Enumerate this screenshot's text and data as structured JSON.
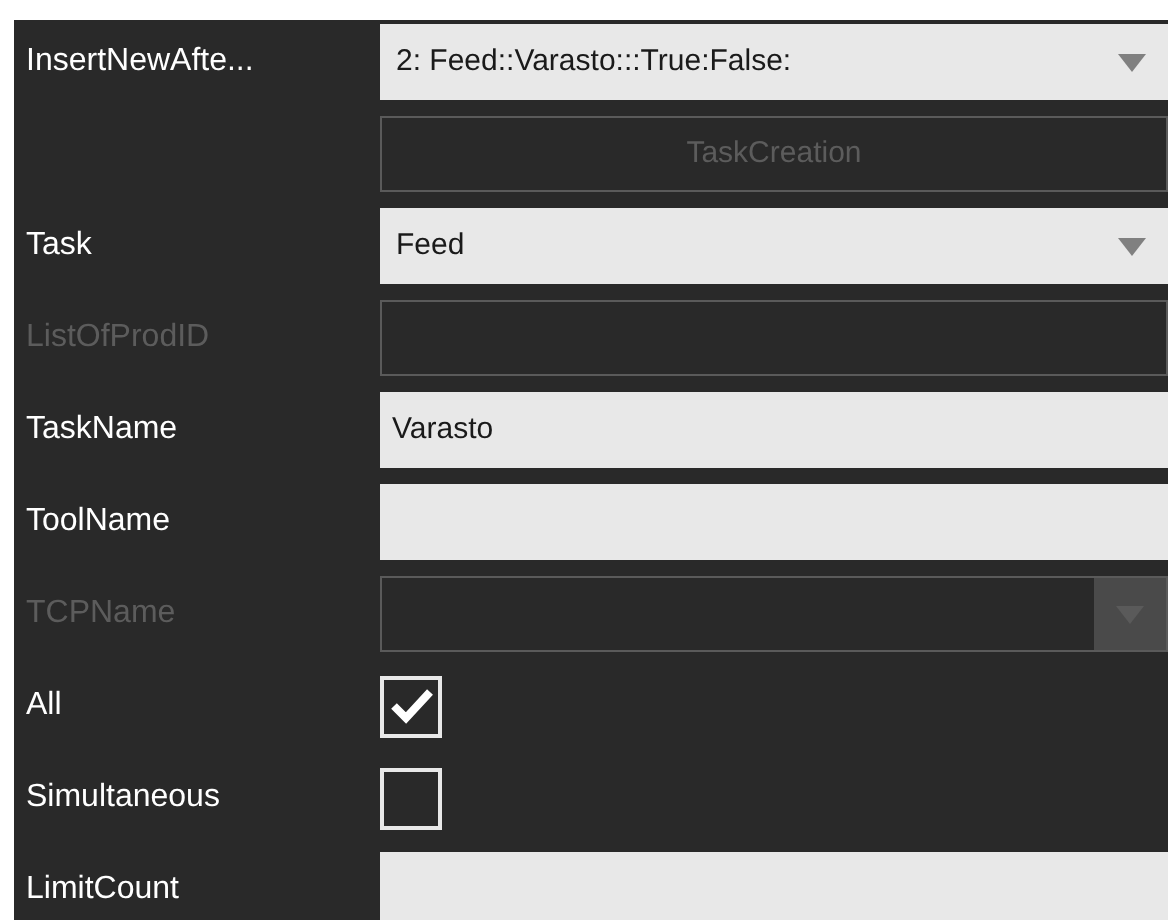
{
  "rows": [
    {
      "label": "InsertNewAfte...",
      "kind": "combo",
      "value": "2: Feed::Varasto:::True:False:",
      "disabled": false
    },
    {
      "kind": "button",
      "text": "TaskCreation",
      "disabled": true
    },
    {
      "label": "Task",
      "kind": "combo",
      "value": "Feed",
      "disabled": false
    },
    {
      "label": "ListOfProdID",
      "kind": "text",
      "disabled": true
    },
    {
      "label": "TaskName",
      "kind": "text",
      "value": "Varasto",
      "disabled": false
    },
    {
      "label": "ToolName",
      "kind": "text",
      "disabled": false
    },
    {
      "label": "TCPName",
      "kind": "combo",
      "disabled": true
    },
    {
      "label": "All",
      "kind": "checkbox",
      "checked": true
    },
    {
      "label": "Simultaneous",
      "kind": "checkbox",
      "checked": false
    },
    {
      "label": "LimitCount",
      "kind": "text",
      "disabled": false
    }
  ]
}
